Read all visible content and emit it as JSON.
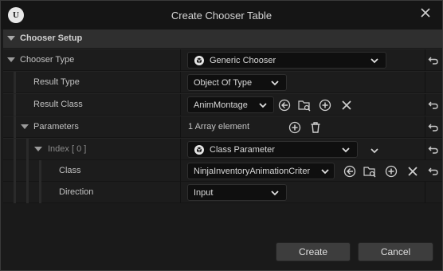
{
  "window": {
    "title": "Create Chooser Table",
    "logo_text": "U"
  },
  "section": {
    "label": "Chooser Setup"
  },
  "rows": {
    "chooser_type": {
      "label": "Chooser Type",
      "value": "Generic Chooser"
    },
    "result_type": {
      "label": "Result Type",
      "value": "Object Of Type"
    },
    "result_class": {
      "label": "Result Class",
      "value": "AnimMontage"
    },
    "parameters": {
      "label": "Parameters",
      "value": "1 Array element"
    },
    "index": {
      "label": "Index",
      "index_value": "[ 0 ]",
      "value": "Class Parameter"
    },
    "class": {
      "label": "Class",
      "value": "NinjaInventoryAnimationCriter"
    },
    "direction": {
      "label": "Direction",
      "value": "Input"
    }
  },
  "buttons": {
    "create": "Create",
    "cancel": "Cancel"
  },
  "colors": {
    "background": "#1a1a1a",
    "panel": "#242424",
    "row": "#1c1c1c",
    "field": "#0f0f0f",
    "button": "#3d3d3d",
    "text": "#c8c8c8"
  },
  "icons": [
    "unreal-logo-icon",
    "close-icon",
    "collapse-arrow-icon",
    "chooser-icon",
    "chevron-down-icon",
    "use-selected-icon",
    "browse-icon",
    "add-icon",
    "clear-icon",
    "delete-icon",
    "reset-to-default-icon"
  ]
}
